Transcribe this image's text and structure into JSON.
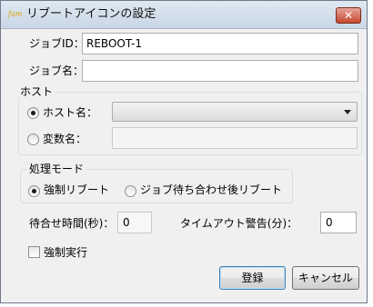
{
  "window": {
    "icon_text": "fam",
    "title": "リブートアイコンの設定",
    "close_glyph": "✕"
  },
  "job_id": {
    "label": "ジョブID：",
    "value": "REBOOT-1"
  },
  "job_name": {
    "label": "ジョブ名：",
    "value": ""
  },
  "host_group": {
    "title": "ホスト",
    "host_name": {
      "label": "ホスト名：",
      "selected": true,
      "value": ""
    },
    "variable_name": {
      "label": "変数名：",
      "selected": false,
      "value": ""
    }
  },
  "mode_group": {
    "title": "処理モード",
    "force_reboot": {
      "label": "強制リブート",
      "selected": true
    },
    "wait_reboot": {
      "label": "ジョブ待ち合わせ後リブート",
      "selected": false
    }
  },
  "wait_time": {
    "label": "待合せ時間(秒)：",
    "value": "0"
  },
  "timeout_warning": {
    "label": "タイムアウト警告(分)：",
    "value": "0"
  },
  "force_execute": {
    "label": "強制実行",
    "checked": false
  },
  "buttons": {
    "register": "登録",
    "cancel": "キャンセル"
  }
}
